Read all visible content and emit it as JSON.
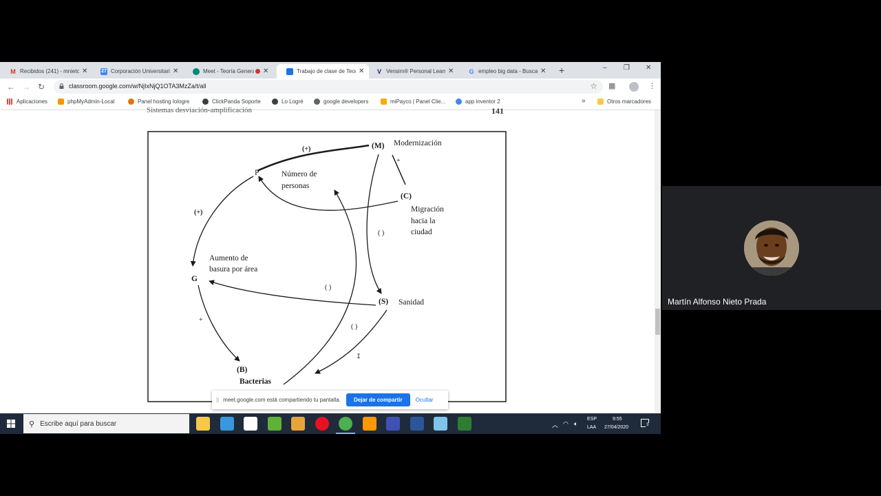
{
  "browser": {
    "tabs": [
      {
        "label": "Recibidos (241) - mnieto",
        "icon": "gmail-icon",
        "color": "#d93025",
        "glyph": "M"
      },
      {
        "label": "Corporación Universitaria",
        "icon": "calendar-icon",
        "color": "#4285f4",
        "glyph": "27"
      },
      {
        "label": "Meet - Teoría General",
        "icon": "meet-icon",
        "color": "#00897b",
        "glyph": ""
      },
      {
        "label": "Trabajo de clase de Teoría",
        "icon": "classroom-icon",
        "color": "#1a73e8",
        "glyph": ""
      },
      {
        "label": "Vensim® Personal Learning",
        "icon": "vensim-icon",
        "color": "#1a237e",
        "glyph": "V"
      },
      {
        "label": "empleo big data - Buscar",
        "icon": "google-icon",
        "color": "#ffffff",
        "glyph": "G"
      }
    ],
    "active_tab": 3,
    "new_tab": "+",
    "window_controls": {
      "minimize": "–",
      "restore": "❐",
      "close": "✕"
    },
    "url": "classroom.google.com/w/NjIxNjQ1OTA3MzZa/t/all",
    "bookmarks": [
      {
        "label": "Aplicaciones",
        "color": "#ea4335"
      },
      {
        "label": "phpMyAdmin-Local",
        "color": "#f29900"
      },
      {
        "label": "Panel hosting Iologre",
        "color": "#e37400"
      },
      {
        "label": "ClickPanda Soporte",
        "color": "#3c4043"
      },
      {
        "label": "Lo Logré",
        "color": "#3c4043"
      },
      {
        "label": "google developers",
        "color": "#5f6368"
      },
      {
        "label": "miPayco | Panel Clie...",
        "color": "#f9ab00"
      },
      {
        "label": "app inventor 2",
        "color": "#4285f4"
      }
    ],
    "more_bookmarks": "»",
    "other_bookmarks": "Otros marcadores"
  },
  "page": {
    "running_head": "Sistemas desviación-amplificación",
    "page_number": "141"
  },
  "diagram": {
    "nodes": {
      "M": "(M)",
      "P": "P",
      "C": "(C)",
      "G": "G",
      "S": "(S)",
      "B": "(B)"
    },
    "labels": {
      "modernizacion": "Modernización",
      "numero_1": "Número de",
      "numero_2": "personas",
      "migracion_1": "Migración",
      "migracion_2": "hacia la",
      "migracion_3": "ciudad",
      "basura_1": "Aumento de",
      "basura_2": "basura por área",
      "sanidad": "Sanidad",
      "bacterias": "Bacterias"
    },
    "signs": {
      "mp": "(+)",
      "mc": "+",
      "pg": "(+)",
      "ms": "(   )",
      "sg": "(   )",
      "sb": "(   )",
      "gb": "+"
    }
  },
  "share_banner": {
    "grip": "||",
    "message": "meet.google.com está compartiendo tu pantalla.",
    "stop_label": "Dejar de compartir",
    "hide_label": "Ocultar"
  },
  "taskbar": {
    "search_placeholder": "Escribe aquí para buscar",
    "apps": [
      {
        "name": "file-explorer-icon",
        "color": "#f7c948"
      },
      {
        "name": "desktop-icon",
        "color": "#3a96dd"
      },
      {
        "name": "store-icon",
        "color": "#ffffff"
      },
      {
        "name": "excel-like-icon",
        "color": "#5fb236"
      },
      {
        "name": "media-icon",
        "color": "#e8a33d"
      },
      {
        "name": "recorder-icon",
        "color": "#e81123"
      },
      {
        "name": "chrome-icon",
        "color": "#4caf50"
      },
      {
        "name": "sublime-icon",
        "color": "#ff9800"
      },
      {
        "name": "save-app-icon",
        "color": "#3f51b5"
      },
      {
        "name": "word-icon",
        "color": "#2b579a"
      },
      {
        "name": "paint-icon",
        "color": "#7fc4ea"
      },
      {
        "name": "app-icon",
        "color": "#2e7d32"
      }
    ],
    "lang_1": "ESP",
    "lang_2": "LAA",
    "time": "9:55",
    "date": "27/04/2020",
    "notifications": "3"
  },
  "participant": {
    "name": "Martín Alfonso Nieto Prada"
  }
}
